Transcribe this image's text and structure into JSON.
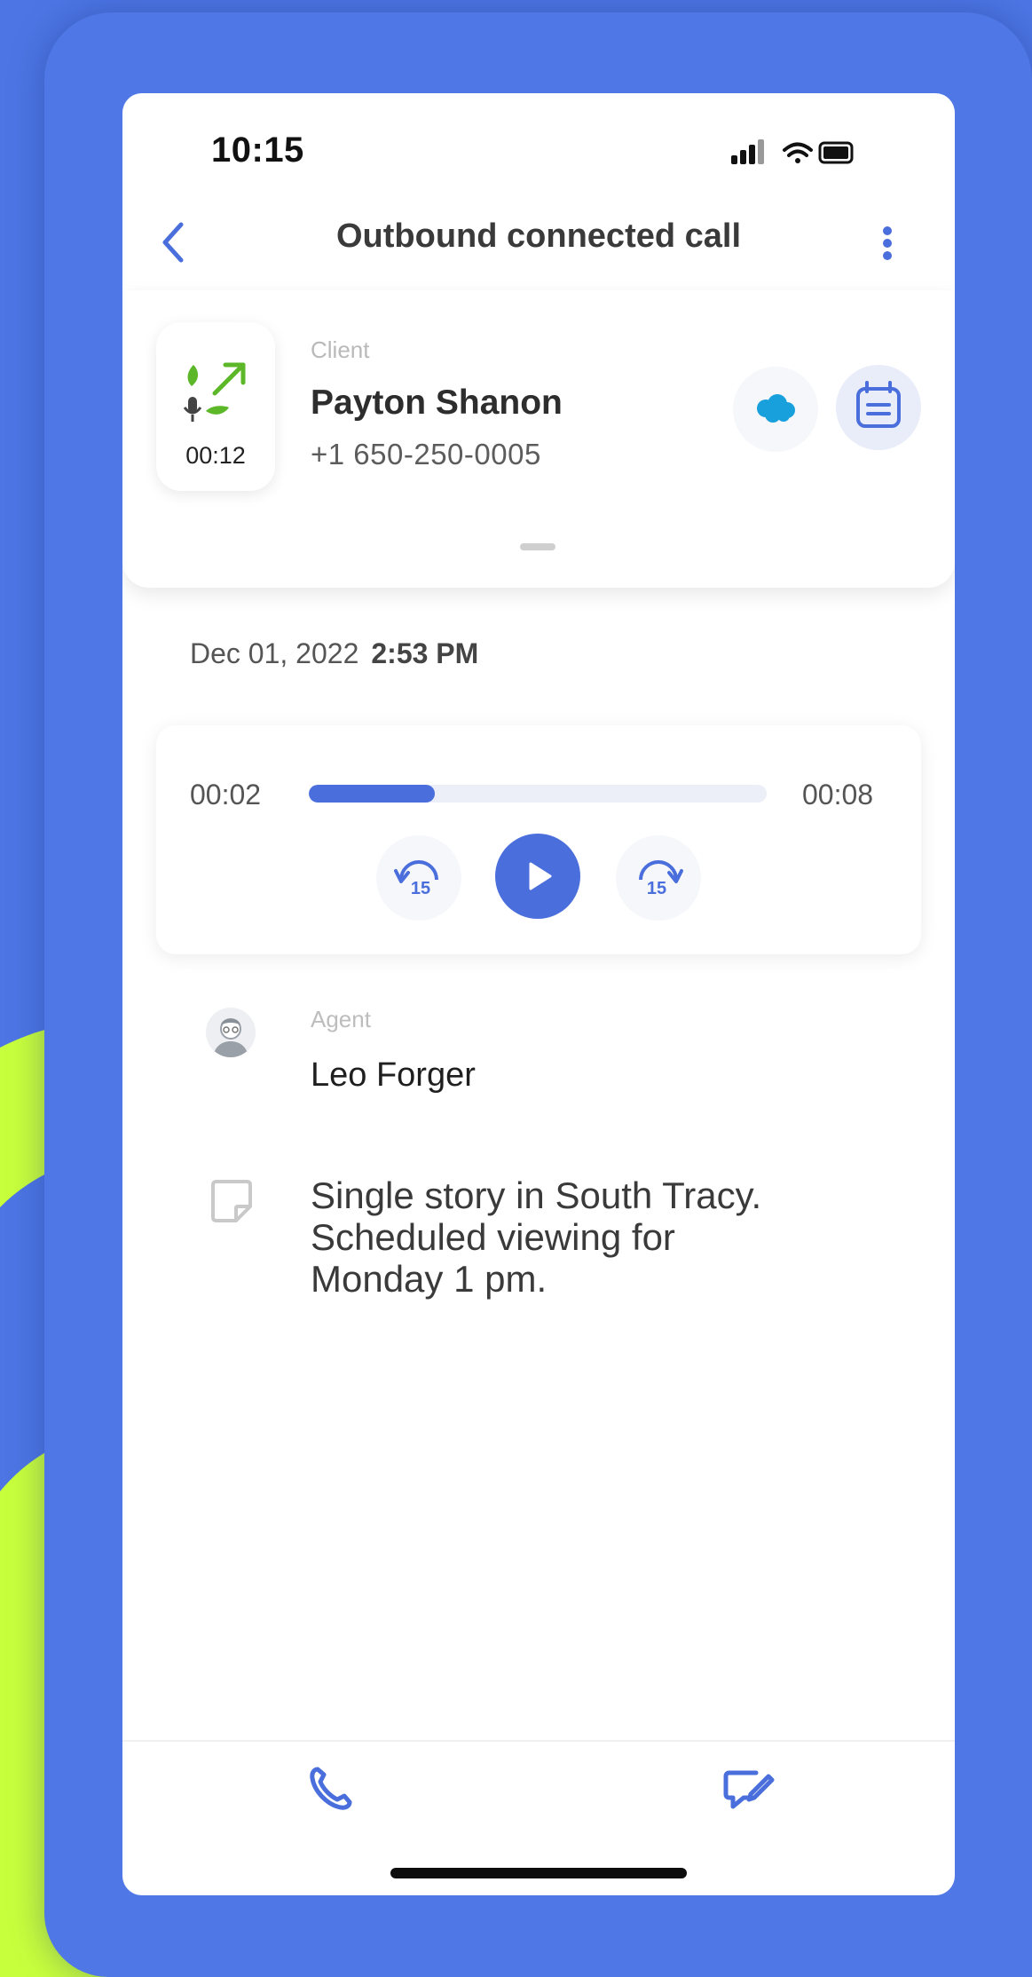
{
  "status_bar": {
    "time": "10:15"
  },
  "header": {
    "title": "Outbound connected call"
  },
  "client": {
    "call_duration": "00:12",
    "label": "Client",
    "name": "Payton Shanon",
    "phone": "+1 650-250-0005"
  },
  "call_date": {
    "date": "Dec 01, 2022",
    "time": "2:53 PM"
  },
  "player": {
    "elapsed": "00:02",
    "total": "00:08",
    "progress_fraction": 0.275,
    "rewind_seconds": "15",
    "forward_seconds": "15"
  },
  "agent": {
    "label": "Agent",
    "name": "Leo Forger"
  },
  "note": {
    "text": "Single story in South Tracy. Scheduled viewing for Monday 1 pm."
  },
  "icons": {
    "back": "chevron-left-icon",
    "more": "more-vertical-icon",
    "salesforce": "salesforce-cloud-icon",
    "calendar": "calendar-icon",
    "phone": "phone-icon",
    "message": "message-edit-icon"
  },
  "colors": {
    "accent": "#4a6fdc",
    "background": "#4d76e4",
    "decor": "#c8ff3c",
    "call_green": "#5cb829"
  }
}
